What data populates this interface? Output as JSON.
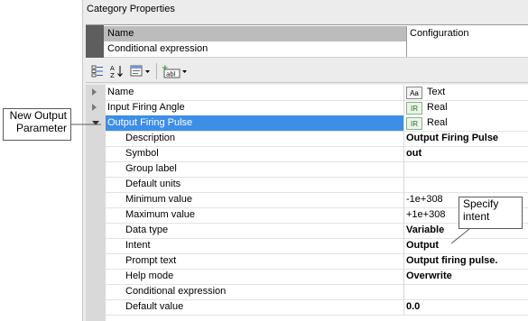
{
  "panel": {
    "title": "Category Properties"
  },
  "header_grid": {
    "rows": [
      {
        "name": "Name",
        "value": "Configuration"
      },
      {
        "name": "Conditional expression",
        "value": ""
      }
    ]
  },
  "toolbar": {
    "buttons": [
      {
        "icon": "categorized-view-icon"
      },
      {
        "icon": "alphabetical-sort-icon"
      },
      {
        "icon": "property-pages-dropdown-icon"
      },
      {
        "icon": "add-parameter-dropdown-icon"
      }
    ]
  },
  "properties": {
    "rows": [
      {
        "name": "Name",
        "badge": "Aa",
        "type": "Text",
        "level": 0,
        "state": "collapsed"
      },
      {
        "name": "Input Firing Angle",
        "badge": "IR",
        "type": "Real",
        "level": 0,
        "state": "collapsed"
      },
      {
        "name": "Output Firing Pulse",
        "badge": "IR",
        "type": "Real",
        "level": 0,
        "state": "expanded"
      },
      {
        "name": "Description",
        "value": "Output Firing Pulse",
        "bold": true,
        "level": 1
      },
      {
        "name": "Symbol",
        "value": "out",
        "bold": true,
        "level": 1
      },
      {
        "name": "Group label",
        "value": "",
        "level": 1
      },
      {
        "name": "Default units",
        "value": "",
        "level": 1
      },
      {
        "name": "Minimum value",
        "value": "-1e+308",
        "level": 1
      },
      {
        "name": "Maximum value",
        "value": "+1e+308",
        "level": 1
      },
      {
        "name": "Data type",
        "value": "Variable",
        "bold": true,
        "level": 1
      },
      {
        "name": "Intent",
        "value": "Output",
        "bold": true,
        "level": 1
      },
      {
        "name": "Prompt text",
        "value": "Output firing pulse.",
        "bold": true,
        "level": 1
      },
      {
        "name": "Help mode",
        "value": "Overwrite",
        "bold": true,
        "level": 1
      },
      {
        "name": "Conditional expression",
        "value": "",
        "level": 1
      },
      {
        "name": "Default value",
        "value": "0.0",
        "bold": true,
        "level": 1
      }
    ]
  },
  "callouts": {
    "left": {
      "line1": "New Output",
      "line2": "Parameter"
    },
    "right": {
      "line1": "Specify",
      "line2": "intent"
    }
  }
}
